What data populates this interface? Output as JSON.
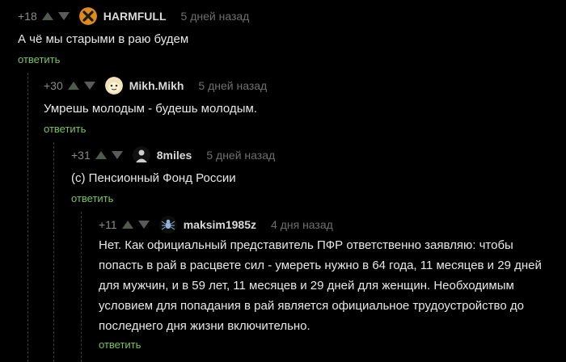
{
  "comments": [
    {
      "score": "+18",
      "username": "HARMFULL",
      "time": "5 дней назад",
      "text": "А чё мы старыми в раю будем",
      "reply_label": "ответить",
      "avatar_icon": "x-circle-avatar"
    },
    {
      "score": "+30",
      "username": "Mikh.Mikh",
      "time": "5 дней назад",
      "text": "Умрешь молодым - будешь молодым.",
      "reply_label": "ответить",
      "avatar_icon": "cartoon-face-avatar"
    },
    {
      "score": "+31",
      "username": "8miles",
      "time": "5 дней назад",
      "text": "(c) Пенсионный Фонд России",
      "reply_label": "ответить",
      "avatar_icon": "dark-figure-avatar"
    },
    {
      "score": "+11",
      "username": "maksim1985z",
      "time": "4 дня назад",
      "text_lines": [
        "Нет. Как официальный представитель ПФР ответственно заявляю: чтобы",
        "попасть в рай в расцвете сил - умереть нужно в 64 года, 11 месяцев и 29 дней",
        "для мужчин, и в 59 лет, 11 месяцев и 29 дней для женщин. Необходимым",
        "условием для попадания в рай является официальное трудоустройство до",
        "последнего дня жизни включительно."
      ],
      "reply_label": "ответить",
      "avatar_icon": "spider-avatar"
    }
  ],
  "colors": {
    "background": "#000000",
    "reply_link": "#7cc45a",
    "vote_up": "#4f5a4f",
    "vote_down": "#5a5a5a"
  }
}
